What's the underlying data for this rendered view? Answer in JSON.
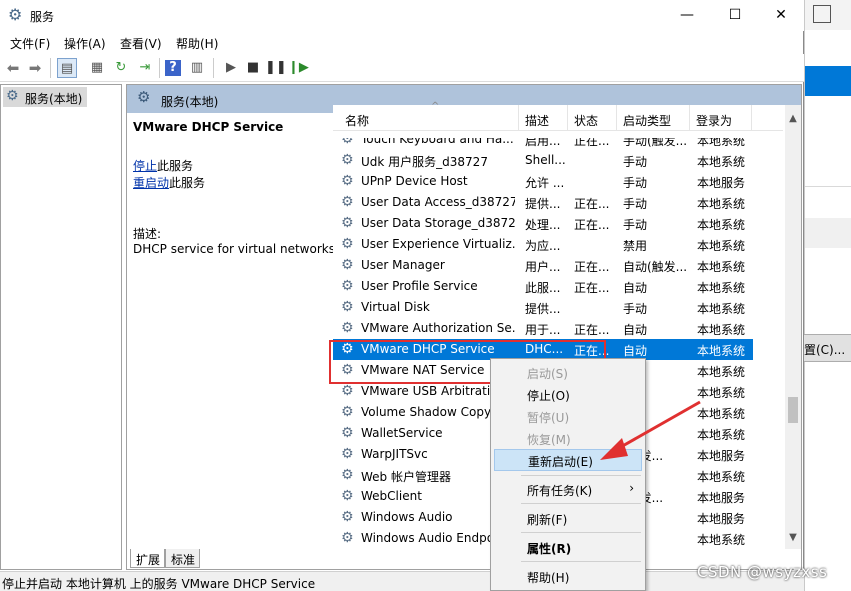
{
  "window": {
    "title": "服务",
    "controls": {
      "minimize": "—",
      "maximize": "☐",
      "close": "✕"
    }
  },
  "menu": [
    "文件(F)",
    "操作(A)",
    "查看(V)",
    "帮助(H)"
  ],
  "toolbar_icons": [
    "back-icon",
    "forward-icon",
    "console-tree-icon",
    "properties-icon",
    "refresh-icon",
    "export-icon",
    "help-icon",
    "show-panel-icon",
    "start-icon",
    "stop-icon",
    "pause-icon",
    "restart-icon"
  ],
  "tree": {
    "root": "服务(本地)"
  },
  "panel": {
    "title": "服务(本地)",
    "detail": {
      "service_name": "VMware DHCP Service",
      "stop_link": "停止",
      "stop_suffix": "此服务",
      "restart_link": "重启动",
      "restart_suffix": "此服务",
      "desc_label": "描述:",
      "desc_text": "DHCP service for virtual networks."
    },
    "columns": [
      "名称",
      "描述",
      "状态",
      "启动类型",
      "登录为"
    ],
    "rows": [
      {
        "name": "Touch Keyboard and Ha...",
        "desc": "启用...",
        "status": "正在...",
        "startup": "手动(触发...",
        "logon": "本地系统"
      },
      {
        "name": "Udk 用户服务_d38727",
        "desc": "Shell...",
        "status": "",
        "startup": "手动",
        "logon": "本地系统"
      },
      {
        "name": "UPnP Device Host",
        "desc": "允许 ...",
        "status": "",
        "startup": "手动",
        "logon": "本地服务"
      },
      {
        "name": "User Data Access_d38727",
        "desc": "提供...",
        "status": "正在...",
        "startup": "手动",
        "logon": "本地系统"
      },
      {
        "name": "User Data Storage_d38727",
        "desc": "处理...",
        "status": "正在...",
        "startup": "手动",
        "logon": "本地系统"
      },
      {
        "name": "User Experience Virtualiz...",
        "desc": "为应...",
        "status": "",
        "startup": "禁用",
        "logon": "本地系统"
      },
      {
        "name": "User Manager",
        "desc": "用户...",
        "status": "正在...",
        "startup": "自动(触发...",
        "logon": "本地系统"
      },
      {
        "name": "User Profile Service",
        "desc": "此服...",
        "status": "正在...",
        "startup": "自动",
        "logon": "本地系统"
      },
      {
        "name": "Virtual Disk",
        "desc": "提供...",
        "status": "",
        "startup": "手动",
        "logon": "本地系统"
      },
      {
        "name": "VMware Authorization Se...",
        "desc": "用于...",
        "status": "正在...",
        "startup": "自动",
        "logon": "本地系统"
      },
      {
        "name": "VMware DHCP Service",
        "desc": "DHC...",
        "status": "正在...",
        "startup": "自动",
        "logon": "本地系统",
        "selected": true
      },
      {
        "name": "VMware NAT Service",
        "desc": "",
        "status": "",
        "startup": "",
        "logon": "本地系统"
      },
      {
        "name": "VMware USB Arbitratio...",
        "desc": "",
        "status": "",
        "startup": "",
        "logon": "本地系统"
      },
      {
        "name": "Volume Shadow Copy",
        "desc": "",
        "status": "",
        "startup": "",
        "logon": "本地系统"
      },
      {
        "name": "WalletService",
        "desc": "",
        "status": "",
        "startup": "",
        "logon": "本地系统"
      },
      {
        "name": "WarpJITSvc",
        "desc": "",
        "status": "",
        "startup": "(触发...",
        "logon": "本地服务"
      },
      {
        "name": "Web 帐户管理器",
        "desc": "",
        "status": "",
        "startup": "",
        "logon": "本地系统"
      },
      {
        "name": "WebClient",
        "desc": "",
        "status": "",
        "startup": "(触发...",
        "logon": "本地服务"
      },
      {
        "name": "Windows Audio",
        "desc": "",
        "status": "",
        "startup": "",
        "logon": "本地服务"
      },
      {
        "name": "Windows Audio Endpo...",
        "desc": "",
        "status": "",
        "startup": "",
        "logon": "本地系统"
      }
    ]
  },
  "tabs": [
    "扩展",
    "标准"
  ],
  "context_menu": [
    {
      "label": "启动(S)",
      "state": "disabled"
    },
    {
      "label": "停止(O)",
      "state": "enabled"
    },
    {
      "label": "暂停(U)",
      "state": "disabled"
    },
    {
      "label": "恢复(M)",
      "state": "disabled"
    },
    {
      "label": "重新启动(E)",
      "state": "hover"
    },
    {
      "label": "所有任务(K)",
      "state": "enabled",
      "submenu": "›"
    },
    {
      "label": "刷新(F)",
      "state": "enabled"
    },
    {
      "label": "属性(R)",
      "state": "bold"
    },
    {
      "label": "帮助(H)",
      "state": "enabled"
    }
  ],
  "statusbar": "停止并启动 本地计算机 上的服务 VMware DHCP Service",
  "background_app": {
    "button_label": "置(C)..."
  },
  "watermark": "CSDN @wsyzxss",
  "colors": {
    "selection": "#0078d7",
    "highlight_box": "#e03030",
    "arrow": "#e03030",
    "panel_header": "#afc3db"
  }
}
